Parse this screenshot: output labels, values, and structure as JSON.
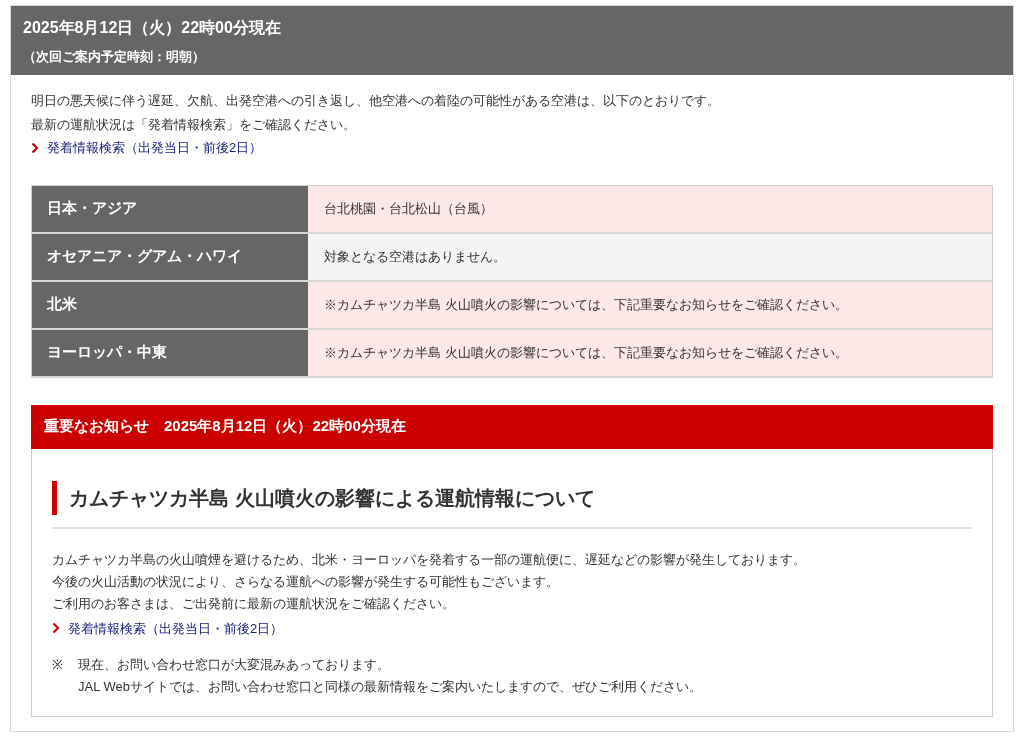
{
  "header": {
    "title": "2025年8月12日（火）22時00分現在",
    "subtitle": "（次回ご案内予定時刻：明朝）"
  },
  "intro": [
    "明日の悪天候に伴う遅延、欠航、出発空港への引き返し、他空港への着陸の可能性がある空港は、以下のとおりです。",
    "最新の運航状況は「発着情報検索」をご確認ください。"
  ],
  "intro_link": "発着情報検索（出発当日・前後2日）",
  "regions": [
    {
      "region": "日本・アジア",
      "airports": "台北桃園・台北松山（台風）",
      "affected": true
    },
    {
      "region": "オセアニア・グアム・ハワイ",
      "airports": "対象となる空港はありません。",
      "affected": false
    },
    {
      "region": "北米",
      "airports": "※カムチャツカ半島 火山噴火の影響については、下記重要なお知らせをご確認ください。",
      "affected": true
    },
    {
      "region": "ヨーロッパ・中東",
      "airports": "※カムチャツカ半島 火山噴火の影響については、下記重要なお知らせをご確認ください。",
      "affected": true
    }
  ],
  "notice": {
    "banner": "重要なお知らせ　2025年8月12日（火）22時00分現在",
    "heading": "カムチャツカ半島 火山噴火の影響による運航情報について",
    "body": [
      "カムチャツカ半島の火山噴煙を避けるため、北米・ヨーロッパを発着する一部の運航便に、遅延などの影響が発生しております。",
      "今後の火山活動の状況により、さらなる運航への影響が発生する可能性もございます。",
      "ご利用のお客さまは、ご出発前に最新の運航状況をご確認ください。"
    ],
    "link": "発着情報検索（出発当日・前後2日）",
    "note_mark": "※",
    "note": [
      "現在、お問い合わせ窓口が大変混みあっております。",
      "JAL Webサイトでは、お問い合わせ窓口と同様の最新情報をご案内いたしますので、ぜひご利用ください。"
    ]
  }
}
